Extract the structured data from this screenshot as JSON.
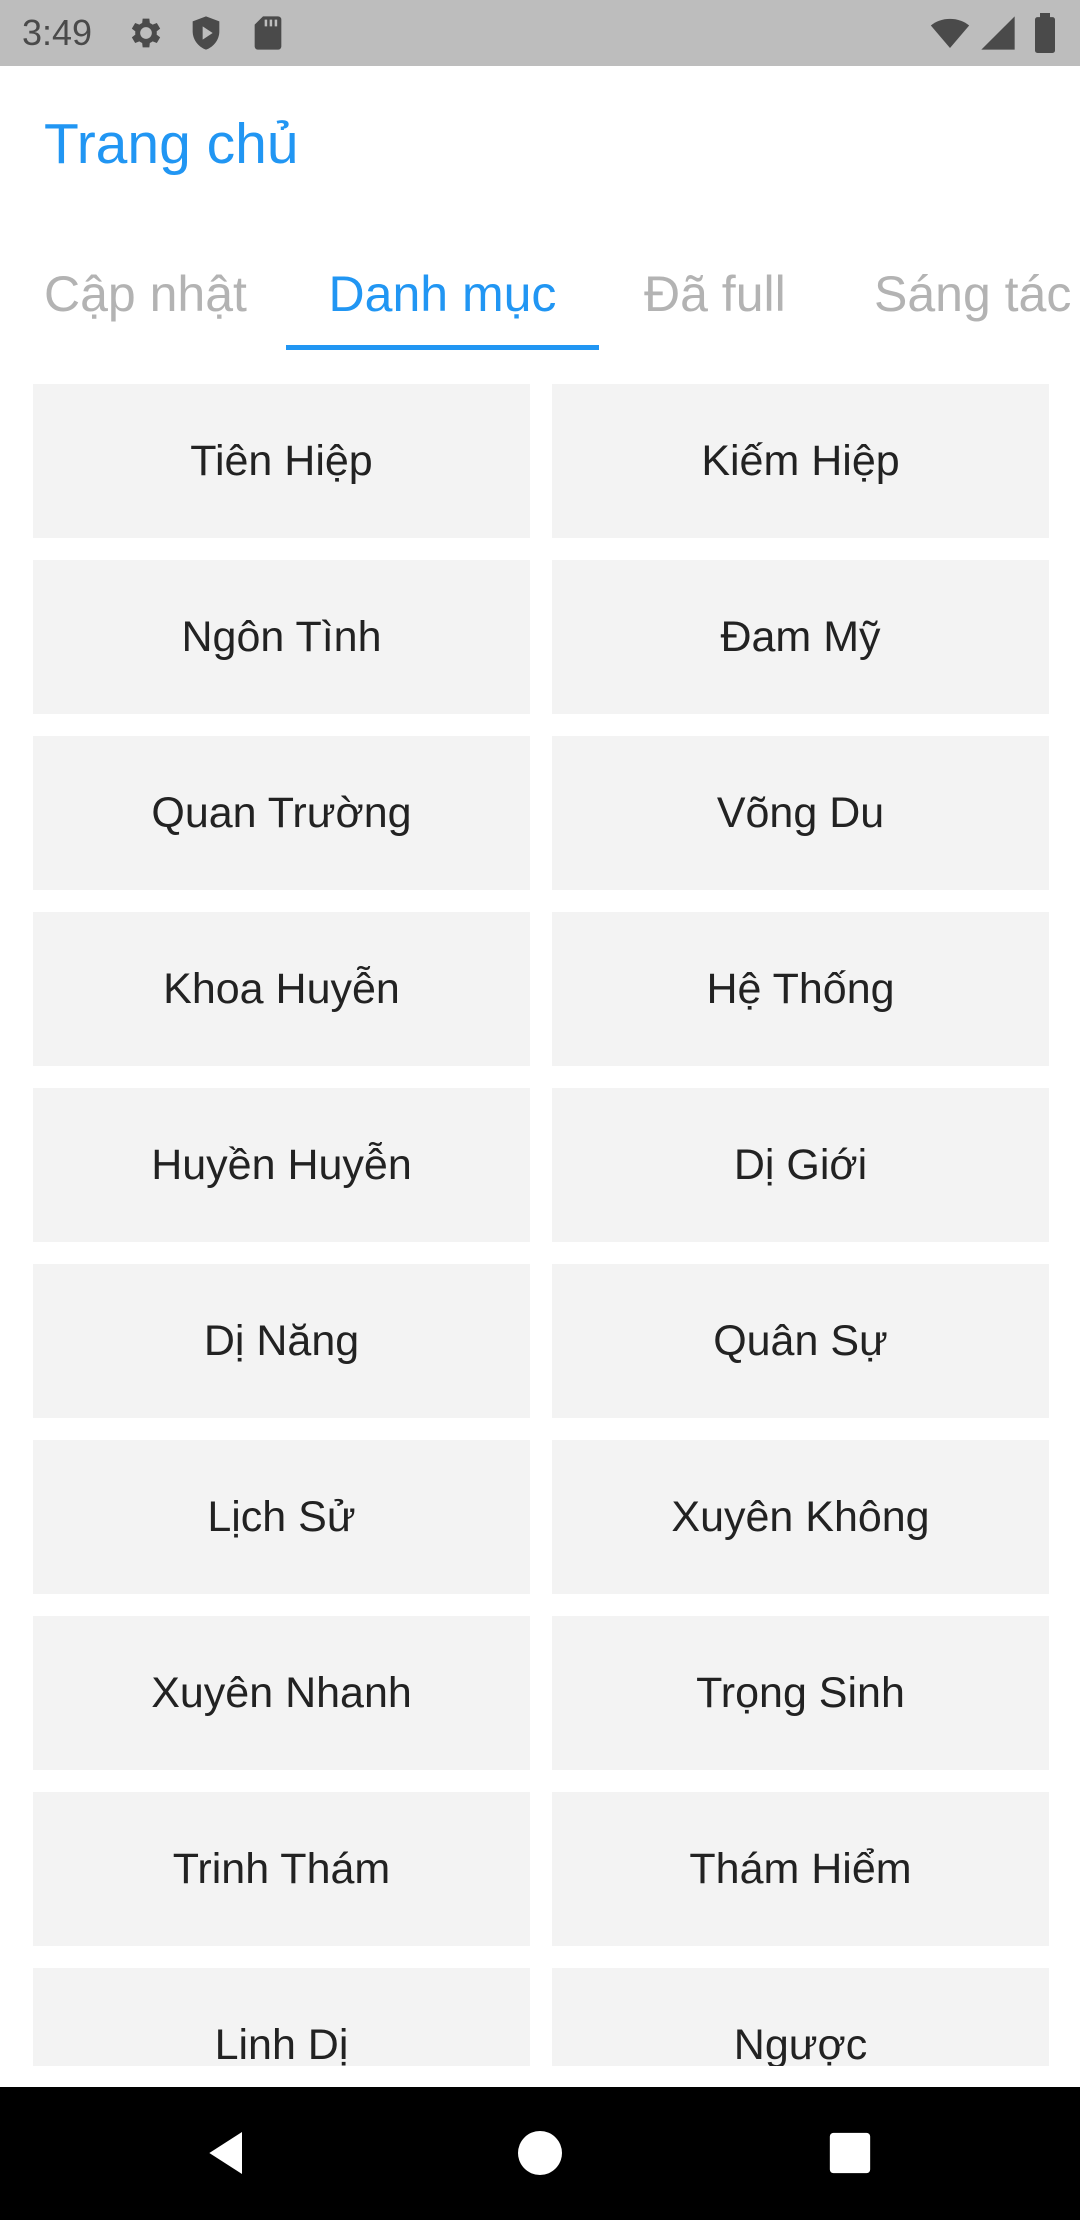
{
  "status_bar": {
    "time": "3:49",
    "left_icons": [
      "gear-icon",
      "shield-icon",
      "sd-card-icon"
    ],
    "right_icons": [
      "wifi-icon",
      "signal-icon",
      "battery-icon"
    ]
  },
  "header": {
    "title": "Trang chủ"
  },
  "tabs": [
    {
      "label": "Cập nhật",
      "active": false
    },
    {
      "label": "Danh mục",
      "active": true
    },
    {
      "label": "Đã full",
      "active": false
    },
    {
      "label": "Sáng tác",
      "active": false
    }
  ],
  "categories": [
    "Tiên Hiệp",
    "Kiếm Hiệp",
    "Ngôn Tình",
    "Đam Mỹ",
    "Quan Trường",
    "Võng Du",
    "Khoa Huyễn",
    "Hệ Thống",
    "Huyền Huyễn",
    "Dị Giới",
    "Dị Năng",
    "Quân Sự",
    "Lịch Sử",
    "Xuyên Không",
    "Xuyên Nhanh",
    "Trọng Sinh",
    "Trinh Thám",
    "Thám Hiểm",
    "Linh Dị",
    "Ngược"
  ],
  "nav_bar": {
    "icons": [
      "back-icon",
      "home-icon",
      "recents-icon"
    ]
  },
  "colors": {
    "accent": "#2196f3",
    "tab_inactive": "#b3b3b3",
    "tile_bg": "#f3f3f3",
    "status_bar_bg": "#bdbdbd"
  }
}
